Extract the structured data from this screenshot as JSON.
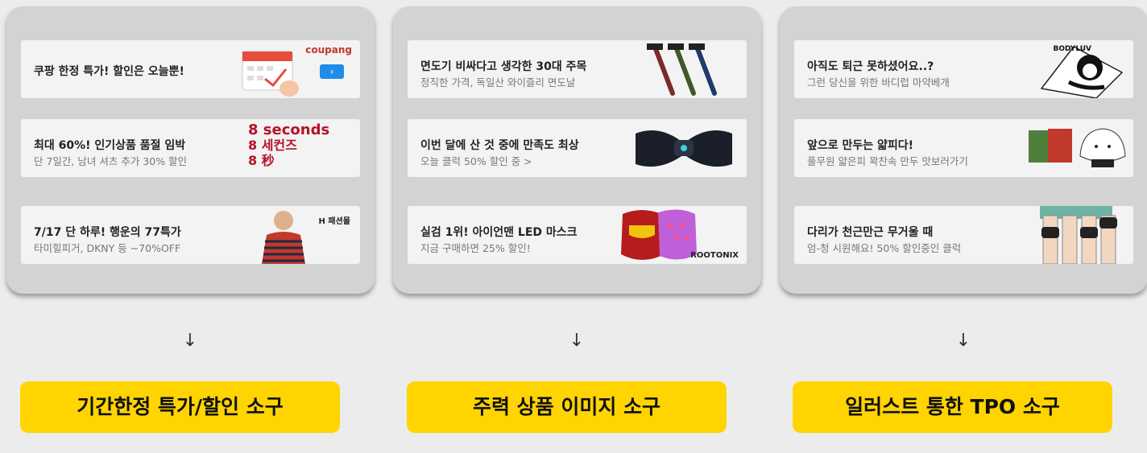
{
  "columns": [
    {
      "banners": [
        {
          "title": "쿠팡 한정 특가! 할인은 오늘뿐!",
          "subtitle": "",
          "brand": "coupang"
        },
        {
          "title": "최대 60%! 인기상품 품절 임박",
          "subtitle": "단 7일간, 남녀 셔츠 추가 30% 할인",
          "brand_lines": [
            "8 seconds",
            "8 세컨즈",
            "8 秒"
          ]
        },
        {
          "title": "7/17 단 하루! 행운의 77특가",
          "subtitle": "타미힐피거, DKNY 등 ~70%OFF",
          "brand": "H 패션몰"
        }
      ],
      "arrow": "↓",
      "label": "기간한정 특가/할인 소구"
    },
    {
      "banners": [
        {
          "title": "면도기 비싸다고 생각한 30대 주목",
          "subtitle": "정직한 가격, 독일산 와이즐리 면도날"
        },
        {
          "title": "이번 달에 산 것 중에 만족도 최상",
          "subtitle": "오늘 클럭 50% 할인 중 >"
        },
        {
          "title": "실검 1위! 아이언맨 LED 마스크",
          "subtitle": "지금 구매하면 25% 할인!",
          "brand": "ROOTONIX"
        }
      ],
      "arrow": "↓",
      "label": "주력 상품 이미지 소구"
    },
    {
      "banners": [
        {
          "title": "아직도 퇴근 못하셨어요..?",
          "subtitle": "그런 당신을 위한 바디럽 마약베개",
          "brand": "BODYLUV"
        },
        {
          "title": "앞으로 만두는 얇피다!",
          "subtitle": "풀무원 얇은피 꽉찬속 만두 맛보러가기"
        },
        {
          "title": "다리가 천근만근 무거울 때",
          "subtitle": "엄-청 시원해요! 50% 할인중인 클럭"
        }
      ],
      "arrow": "↓",
      "label": "일러스트 통한 TPO 소구"
    }
  ],
  "colors": {
    "label_bg": "#ffd400",
    "panel_bg": "#d3d3d3",
    "coupang_button": "#1e8de8",
    "eightsec_red": "#b5122b"
  }
}
